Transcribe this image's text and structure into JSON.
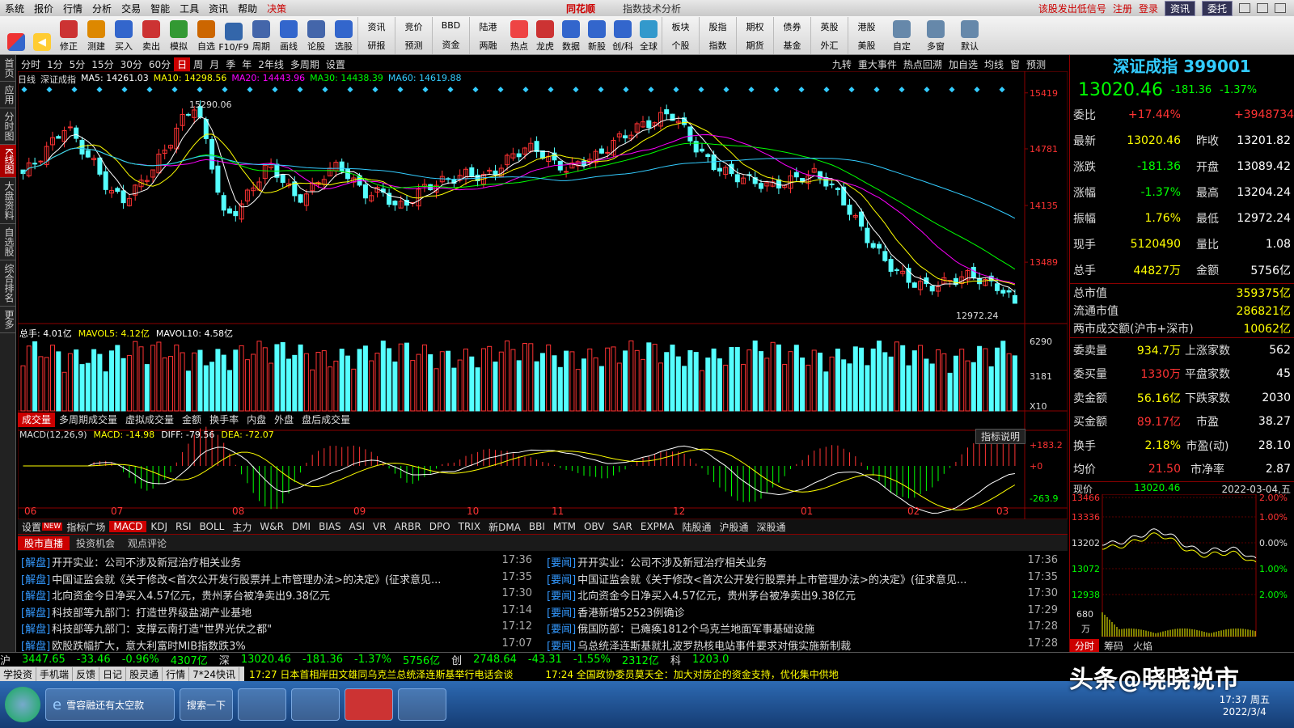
{
  "menu": {
    "items": [
      "系统",
      "报价",
      "行情",
      "分析",
      "交易",
      "智能",
      "工具",
      "资讯",
      "帮助"
    ],
    "special": "决策",
    "app_title": "同花顺",
    "subtitle": "指数技术分析",
    "right_links": [
      "该股发出低信号",
      "注册",
      "登录"
    ],
    "right_buttons": [
      "资讯",
      "委托"
    ]
  },
  "toolbar": {
    "items": [
      "修正",
      "测建",
      "买入",
      "卖出",
      "模拟",
      "自选",
      "F10/F9",
      "周期",
      "画线",
      "论股",
      "选股"
    ],
    "grid": [
      [
        "资讯",
        "研报"
      ],
      [
        "竞价",
        "预测"
      ],
      [
        "BBD",
        "资金"
      ],
      [
        "陆港",
        "两融"
      ]
    ],
    "items2": [
      "热点",
      "龙虎",
      "数据",
      "新股",
      "创/科",
      "全球"
    ],
    "grid2": [
      [
        "板块",
        "个股"
      ],
      [
        "股指",
        "指数"
      ],
      [
        "期权",
        "期货"
      ],
      [
        "债券",
        "基金"
      ],
      [
        "英股",
        "外汇"
      ],
      [
        "港股",
        "美股"
      ]
    ],
    "items3": [
      "自定",
      "多窗",
      "默认"
    ]
  },
  "lefttabs": [
    "首页",
    "应用",
    "分时图",
    "K线图",
    "大盘资料",
    "自选股",
    "综合排名",
    "更多"
  ],
  "periods": [
    "分时",
    "1分",
    "5分",
    "15分",
    "30分",
    "60分",
    "日",
    "周",
    "月",
    "季",
    "年",
    "2年线",
    "多周期",
    "设置"
  ],
  "periods_active": "日",
  "period_right": [
    "九转",
    "重大事件",
    "热点回溯",
    "加自选",
    "均线",
    "窗",
    "预测"
  ],
  "ma_legend": {
    "period": "日线",
    "name": "深证成指",
    "ma5": "MA5: 14261.03",
    "ma10": "MA10: 14298.56",
    "ma20": "MA20: 14443.96",
    "ma30": "MA30: 14438.39",
    "ma60": "MA60: 14619.88"
  },
  "price_axis": [
    "15419",
    "14781",
    "14135",
    "13489"
  ],
  "annot": {
    "high": "15290.06",
    "low": "12972.24"
  },
  "vol_legend": {
    "total": "总手: 4.01亿",
    "mavol5": "MAVOL5: 4.12亿",
    "mavol10": "MAVOL10: 4.58亿"
  },
  "vol_axis": [
    "6290",
    "3181",
    "X10"
  ],
  "vol_tabs": [
    "成交量",
    "多周期成交量",
    "虚拟成交量",
    "金额",
    "换手率",
    "内盘",
    "外盘",
    "盘后成交量"
  ],
  "macd_legend": {
    "name": "MACD(12,26,9)",
    "macd": "MACD: -14.98",
    "diff": "DIFF: -79.56",
    "dea": "DEA: -72.07"
  },
  "macd_axis": [
    "+183.2",
    "+0",
    "-263.9"
  ],
  "macd_btn": "指标说明",
  "x_months": [
    "06",
    "07",
    "08",
    "09",
    "10",
    "11",
    "12",
    "01",
    "02",
    "03"
  ],
  "bottom_tabs": [
    "设置",
    "指标广场",
    "MACD",
    "KDJ",
    "RSI",
    "BOLL",
    "主力",
    "W&R",
    "DMI",
    "BIAS",
    "ASI",
    "VR",
    "ARBR",
    "DPO",
    "TRIX",
    "新DMA",
    "BBI",
    "MTM",
    "OBV",
    "SAR",
    "EXPMA",
    "陆股通",
    "沪股通",
    "深股通"
  ],
  "bottom_new": "NEW",
  "right": {
    "title": "深证成指 399001",
    "price": "13020.46",
    "chg": "-181.36",
    "pct": "-1.37%",
    "rows": [
      [
        "委比",
        "+17.44%",
        "",
        "+3948734"
      ],
      [
        "最新",
        "13020.46",
        "昨收",
        "13201.82"
      ],
      [
        "涨跌",
        "-181.36",
        "开盘",
        "13089.42"
      ],
      [
        "涨幅",
        "-1.37%",
        "最高",
        "13204.24"
      ],
      [
        "振幅",
        "1.76%",
        "最低",
        "12972.24"
      ],
      [
        "现手",
        "5120490",
        "量比",
        "1.08"
      ],
      [
        "总手",
        "44827万",
        "金额",
        "5756亿"
      ]
    ],
    "rows2": [
      [
        "总市值",
        "359375亿"
      ],
      [
        "流通市值",
        "286821亿"
      ],
      [
        "两市成交额(沪市+深市)",
        "10062亿"
      ]
    ],
    "rows3": [
      [
        "委卖量",
        "934.7万",
        "上涨家数",
        "562"
      ],
      [
        "委买量",
        "1330万",
        "平盘家数",
        "45"
      ],
      [
        "卖金额",
        "56.16亿",
        "下跌家数",
        "2030"
      ],
      [
        "买金额",
        "89.17亿",
        "市盈",
        "38.27"
      ],
      [
        "换手",
        "2.18%",
        "市盈(动)",
        "28.10"
      ],
      [
        "均价",
        "21.50",
        "市净率",
        "2.87"
      ]
    ],
    "mini": {
      "label": "现价",
      "price": "13020.46",
      "date": "2022-03-04,五",
      "left_axis": [
        "13466",
        "13336",
        "13202",
        "13072",
        "12938",
        "680",
        "万"
      ],
      "right_axis": [
        "2.00%",
        "1.00%",
        "0.00%",
        "1.00%",
        "2.00%"
      ],
      "tabs": [
        "分时",
        "筹码",
        "火焰"
      ]
    }
  },
  "news": {
    "tabs": [
      "股市直播",
      "投资机会",
      "观点评论"
    ],
    "left": [
      [
        "[解盘]",
        "开开实业：公司不涉及新冠治疗相关业务",
        "17:36"
      ],
      [
        "[解盘]",
        "中国证监会就《关于修改<首次公开发行股票并上市管理办法>的决定》(征求意见...",
        "17:35"
      ],
      [
        "[解盘]",
        "北向资金今日净买入4.57亿元，贵州茅台被净卖出9.38亿元",
        "17:30"
      ],
      [
        "[解盘]",
        "科技部等九部门：打造世界级盐湖产业基地",
        "17:14"
      ],
      [
        "[解盘]",
        "科技部等九部门：支撑云南打造\"世界光伏之都\"",
        "17:12"
      ],
      [
        "[解盘]",
        "欧股跌幅扩大，意大利富时MIB指数跌3%",
        "17:07"
      ]
    ],
    "right": [
      [
        "[要闻]",
        "开开实业：公司不涉及新冠治疗相关业务",
        "17:36"
      ],
      [
        "[要闻]",
        "中国证监会就《关于修改<首次公开发行股票并上市管理办法>的决定》(征求意见...",
        "17:35"
      ],
      [
        "[要闻]",
        "北向资金今日净买入4.57亿元，贵州茅台被净卖出9.38亿元",
        "17:30"
      ],
      [
        "[要闻]",
        "香港新增52523例确诊",
        "17:29"
      ],
      [
        "[要闻]",
        "俄国防部：已瘫痪1812个乌克兰地面军事基础设施",
        "17:28"
      ],
      [
        "[要闻]",
        "乌总统泽连斯基就扎波罗热核电站事件要求对俄实施新制裁",
        "17:28"
      ]
    ]
  },
  "indexbar": [
    "沪",
    "3447.65",
    "-33.46",
    "-0.96%",
    "4307亿",
    "深",
    "13020.46",
    "-181.36",
    "-1.37%",
    "5756亿",
    "创",
    "2748.64",
    "-43.31",
    "-1.55%",
    "2312亿",
    "科",
    "1203.0"
  ],
  "status": {
    "items": [
      "学投资",
      "手机端",
      "反馈",
      "日记",
      "股灵通",
      "行情",
      "7*24快讯"
    ],
    "ticker": [
      "17:27 日本首相岸田文雄同乌克兰总统泽连斯基举行电话会谈",
      "17:24 全国政协委员莫天全：加大对房企的资金支持，优化集中供地"
    ]
  },
  "taskbar": {
    "ie": "雪容融还有太空款",
    "search": "搜索一下",
    "clock_date": "2022/3/4",
    "clock_day": "周五",
    "clock_time": "17:37"
  },
  "watermark": "头条@晓晓说市",
  "chart_data": {
    "type": "candlestick",
    "title": "深证成指 日线",
    "y_ticks": [
      15419,
      14781,
      14135,
      13489
    ],
    "high": 15290.06,
    "low": 12972.24,
    "last": 13020.46,
    "x_months": [
      "06",
      "07",
      "08",
      "09",
      "10",
      "11",
      "12",
      "01",
      "02",
      "03"
    ],
    "closes_est": [
      14500,
      14650,
      14850,
      15050,
      14800,
      14600,
      14300,
      14200,
      14350,
      14550,
      14800,
      15100,
      15290,
      14700,
      14000,
      14100,
      14350,
      14600,
      14450,
      14200,
      14300,
      14500,
      14600,
      14400,
      14250,
      14300,
      14100,
      14200,
      14350,
      14400,
      14450,
      14500,
      14450,
      14550,
      14700,
      14800,
      14750,
      14600,
      14550,
      14650,
      14700,
      14850,
      14950,
      15050,
      15100,
      15200,
      15000,
      14750,
      14600,
      14500,
      14450,
      14400,
      14350,
      14400,
      14450,
      14500,
      14400,
      14200,
      13950,
      13700,
      13500,
      13350,
      13250,
      13200,
      13250,
      13300,
      13350,
      13250,
      13200,
      13020
    ]
  }
}
